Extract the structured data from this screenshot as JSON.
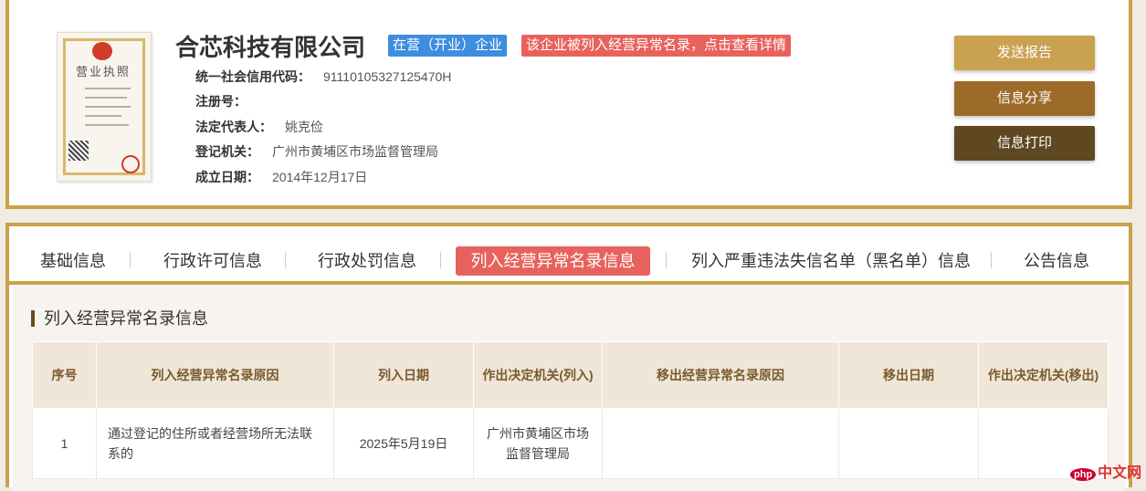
{
  "company": {
    "name": "合芯科技有限公司",
    "status_badge": "在营（开业）企业",
    "warning_badge": "该企业被列入经营异常名录，点击查看详情",
    "license_title": "营业执照",
    "fields": [
      {
        "label": "统一社会信用代码：",
        "value": "91110105327125470H"
      },
      {
        "label": "注册号：",
        "value": ""
      },
      {
        "label": "法定代表人：",
        "value": "姚克俭"
      },
      {
        "label": "登记机关：",
        "value": "广州市黄埔区市场监督管理局"
      },
      {
        "label": "成立日期：",
        "value": "2014年12月17日"
      }
    ]
  },
  "actions": {
    "send": "发送报告",
    "share": "信息分享",
    "print": "信息打印"
  },
  "tabs": [
    {
      "label": "基础信息"
    },
    {
      "label": "行政许可信息"
    },
    {
      "label": "行政处罚信息"
    },
    {
      "label": "列入经营异常名录信息"
    },
    {
      "label": "列入严重违法失信名单（黑名单）信息"
    },
    {
      "label": "公告信息"
    }
  ],
  "section": {
    "title": "列入经营异常名录信息",
    "columns": [
      "序号",
      "列入经营异常名录原因",
      "列入日期",
      "作出决定机关(列入)",
      "移出经营异常名录原因",
      "移出日期",
      "作出决定机关(移出)"
    ],
    "rows": [
      [
        "1",
        "通过登记的住所或者经营场所无法联系的",
        "2025年5月19日",
        "广州市黄埔区市场监督管理局",
        "",
        "",
        ""
      ]
    ]
  },
  "watermark": {
    "badge": "php",
    "text": "中文网"
  },
  "colors": {
    "accent_gold": "#c9a24a",
    "status_blue": "#3d8de0",
    "warning_red": "#e8625d",
    "send_button": "#c9a14f",
    "share_button": "#9c6b29",
    "print_button": "#5f4722"
  }
}
